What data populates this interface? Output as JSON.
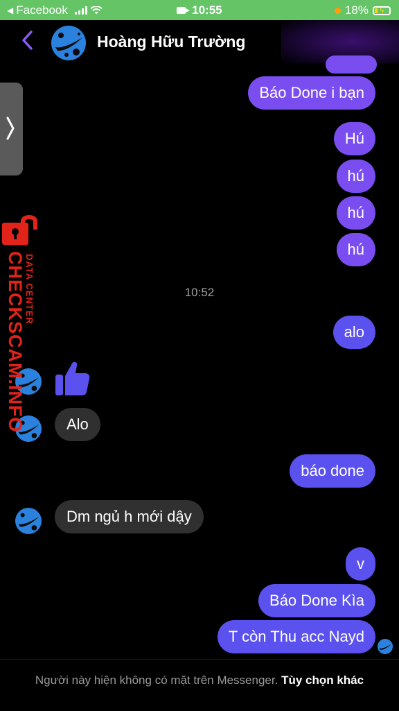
{
  "status_bar": {
    "back_app": "Facebook",
    "time": "10:55",
    "battery": "18%",
    "battery_level": 0.18,
    "icons": [
      "back-triangle-icon",
      "signal-icon",
      "wifi-icon",
      "camera-icon",
      "orange-dot-icon",
      "battery-charging-icon"
    ]
  },
  "header": {
    "contact_name": "Hoàng Hữu Trường",
    "icons": [
      "back-chevron-icon",
      "contact-avatar"
    ]
  },
  "watermark": {
    "brand": "CHECKSCAM.INFO",
    "tagline": "DATA CENTER",
    "brand_color": "#e2231a"
  },
  "messages": [
    {
      "side": "out",
      "text": "Báo Done i bạn"
    },
    {
      "side": "out",
      "text": "Hú"
    },
    {
      "side": "out",
      "text": "hú"
    },
    {
      "side": "out",
      "text": "hú"
    },
    {
      "side": "out",
      "text": "hú"
    },
    {
      "side": "out",
      "text": "alo"
    },
    {
      "side": "in",
      "type": "like",
      "icon": "thumbs-up-icon"
    },
    {
      "side": "in",
      "text": "Alo"
    },
    {
      "side": "out",
      "text": "báo done"
    },
    {
      "side": "in",
      "text": "Dm ngủ h mới dậy"
    },
    {
      "side": "out",
      "text": "v"
    },
    {
      "side": "out",
      "text": "Báo Done Kìa"
    },
    {
      "side": "out",
      "text": "T còn Thu acc Nayd"
    }
  ],
  "timestamp": "10:52",
  "footer": {
    "notice": "Người này hiện không có mặt trên Messenger.",
    "other_options": "Tùy chọn khác"
  },
  "colors": {
    "status_bar": "#65c466",
    "outgoing_purple": "#7a4df0",
    "outgoing_blue": "#5b51ee",
    "incoming": "#303030",
    "accent": "#8a5cf5"
  }
}
